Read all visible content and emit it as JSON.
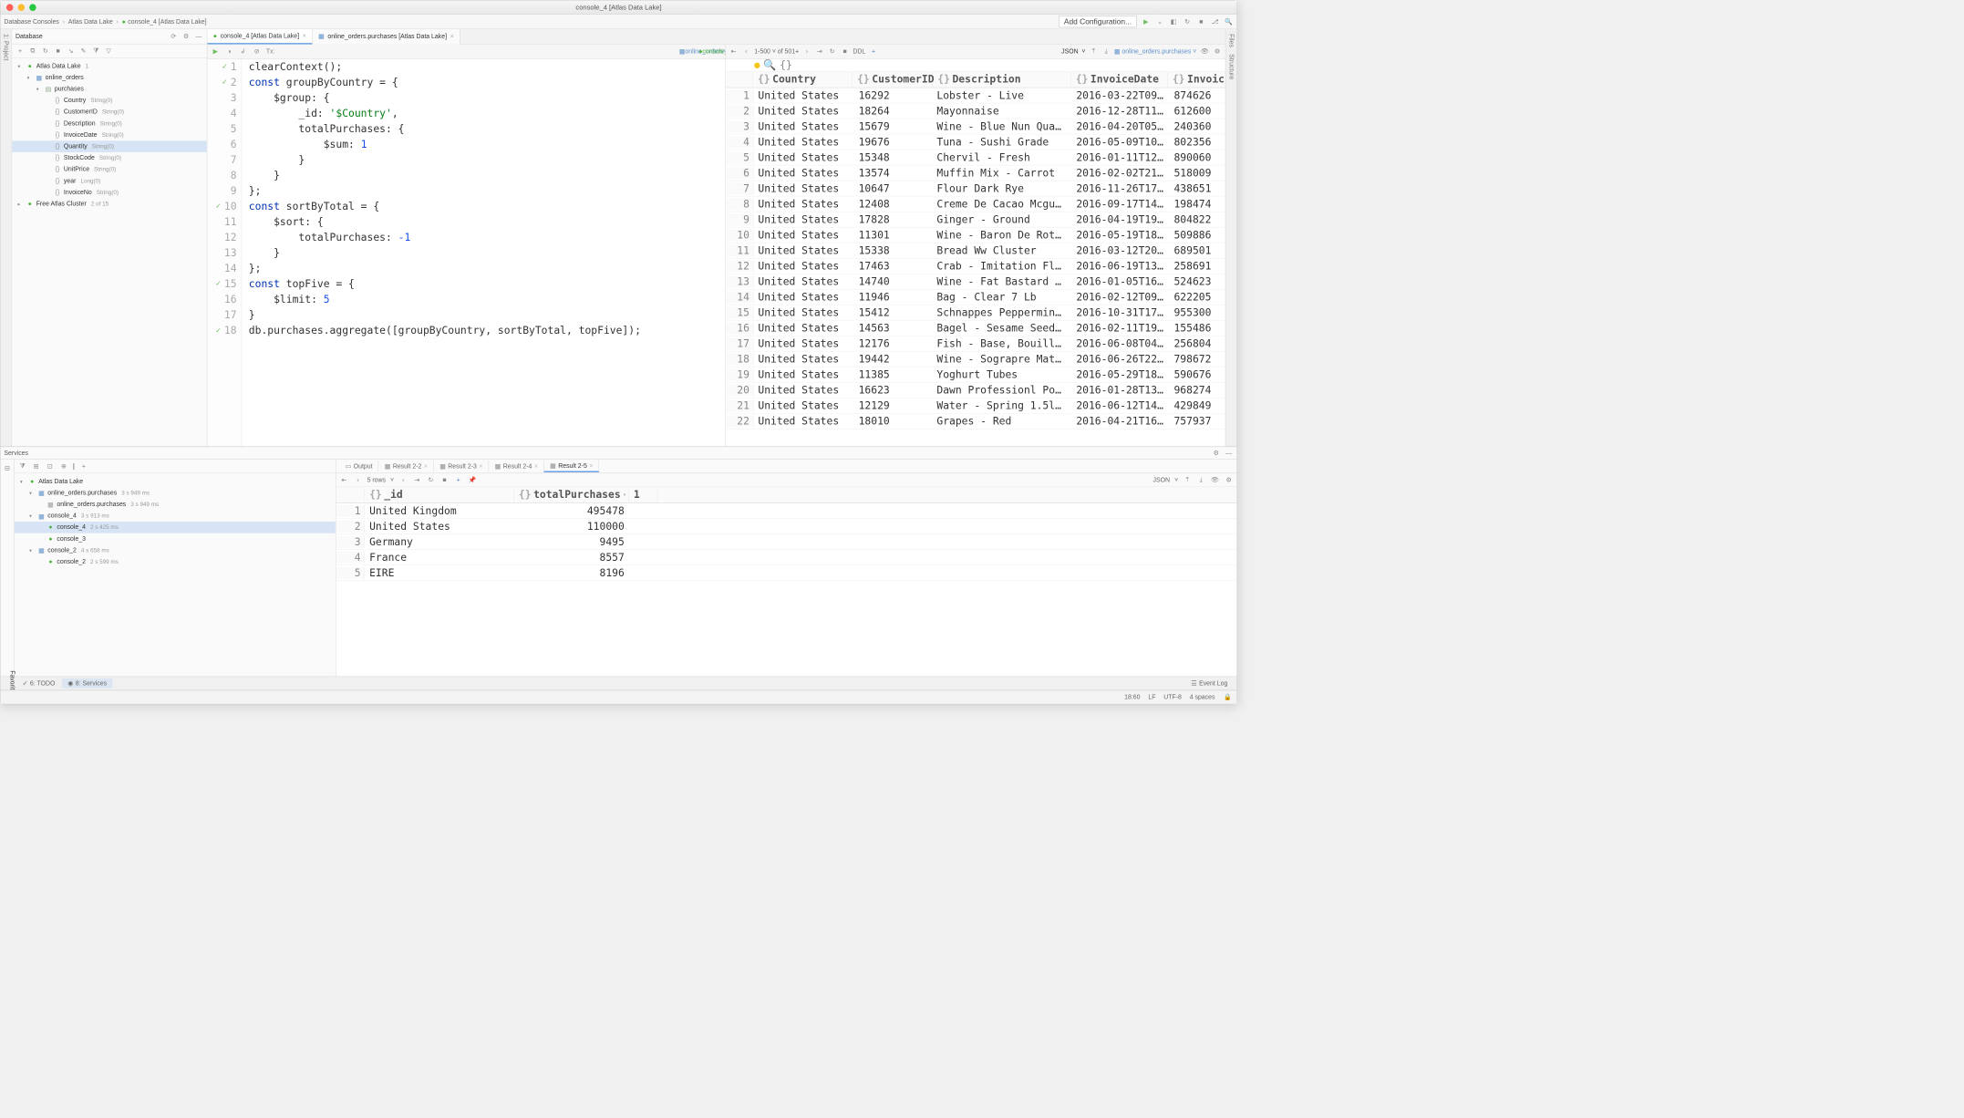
{
  "window_title": "console_4 [Atlas Data Lake]",
  "breadcrumbs": [
    "Database Consoles",
    "Atlas Data Lake",
    "console_4 [Atlas Data Lake]"
  ],
  "nav": {
    "add_config": "Add Configuration..."
  },
  "left_gutter": [
    "1: Project"
  ],
  "right_gutter": [
    "Files",
    "Structure"
  ],
  "db_panel": {
    "title": "Database",
    "tree": [
      {
        "depth": 0,
        "arrow": "open",
        "icon": "mongo",
        "label": "Atlas Data Lake",
        "badge": "1"
      },
      {
        "depth": 1,
        "arrow": "open",
        "icon": "db",
        "label": "online_orders"
      },
      {
        "depth": 2,
        "arrow": "open",
        "icon": "coll",
        "label": "purchases"
      },
      {
        "depth": 3,
        "arrow": "",
        "icon": "field",
        "label": "Country",
        "badge": "String(0)"
      },
      {
        "depth": 3,
        "arrow": "",
        "icon": "field",
        "label": "CustomerID",
        "badge": "String(0)"
      },
      {
        "depth": 3,
        "arrow": "",
        "icon": "field",
        "label": "Description",
        "badge": "String(0)"
      },
      {
        "depth": 3,
        "arrow": "",
        "icon": "field",
        "label": "InvoiceDate",
        "badge": "String(0)"
      },
      {
        "depth": 3,
        "arrow": "",
        "icon": "field",
        "label": "Quantity",
        "badge": "String(0)",
        "selected": true
      },
      {
        "depth": 3,
        "arrow": "",
        "icon": "field",
        "label": "StockCode",
        "badge": "String(0)"
      },
      {
        "depth": 3,
        "arrow": "",
        "icon": "field",
        "label": "UnitPrice",
        "badge": "String(0)"
      },
      {
        "depth": 3,
        "arrow": "",
        "icon": "field",
        "label": "year",
        "badge": "Long(0)"
      },
      {
        "depth": 3,
        "arrow": "",
        "icon": "field",
        "label": "InvoiceNo",
        "badge": "String(0)"
      },
      {
        "depth": 0,
        "arrow": "closed",
        "icon": "mongo",
        "label": "Free Atlas Cluster",
        "badge": "2 of 15"
      }
    ]
  },
  "editor": {
    "tabs": [
      {
        "label": "console_4 [Atlas Data Lake]",
        "active": true
      },
      {
        "label": "online_orders.purchases [Atlas Data Lake]",
        "active": false
      }
    ],
    "context_left": "online_orders",
    "context_right": "console_4",
    "lines": [
      {
        "n": 1,
        "check": true,
        "html": "clearContext();"
      },
      {
        "n": 2,
        "check": true,
        "html": "<span class='tok-kw'>const</span> groupByCountry = {"
      },
      {
        "n": 3,
        "html": "    $group: {"
      },
      {
        "n": 4,
        "html": "        _id: <span class='tok-str'>'$Country'</span>,"
      },
      {
        "n": 5,
        "html": "        totalPurchases: {"
      },
      {
        "n": 6,
        "html": "            $sum: <span class='tok-num'>1</span>"
      },
      {
        "n": 7,
        "html": "        }"
      },
      {
        "n": 8,
        "html": "    }"
      },
      {
        "n": 9,
        "html": "};"
      },
      {
        "n": 10,
        "check": true,
        "html": "<span class='tok-kw'>const</span> sortByTotal = {"
      },
      {
        "n": 11,
        "html": "    $sort: {"
      },
      {
        "n": 12,
        "html": "        totalPurchases: <span class='tok-num'>-1</span>"
      },
      {
        "n": 13,
        "html": "    }"
      },
      {
        "n": 14,
        "html": "};"
      },
      {
        "n": 15,
        "check": true,
        "html": "<span class='tok-kw'>const</span> topFive = {"
      },
      {
        "n": 16,
        "html": "    $limit: <span class='tok-num'>5</span>"
      },
      {
        "n": 17,
        "html": "}"
      },
      {
        "n": 18,
        "check": true,
        "html": "db.purchases.aggregate([groupByCountry, sortByTotal, topFive]);"
      }
    ]
  },
  "results": {
    "pager_range": "1-500",
    "pager_total": "of 501+",
    "ddl_label": "DDL",
    "view_mode": "JSON",
    "path_label": "online_orders.purchases",
    "root_brace": "{}",
    "columns": [
      "Country",
      "CustomerID",
      "Description",
      "InvoiceDate",
      "Invoic"
    ],
    "rows": [
      [
        "United States",
        "16292",
        "Lobster - Live",
        "2016-03-22T09…",
        "874626"
      ],
      [
        "United States",
        "18264",
        "Mayonnaise",
        "2016-12-28T11…",
        "612600"
      ],
      [
        "United States",
        "15679",
        "Wine - Blue Nun Qual…",
        "2016-04-20T05…",
        "240360"
      ],
      [
        "United States",
        "19676",
        "Tuna - Sushi Grade",
        "2016-05-09T10…",
        "802356"
      ],
      [
        "United States",
        "15348",
        "Chervil - Fresh",
        "2016-01-11T12…",
        "890060"
      ],
      [
        "United States",
        "13574",
        "Muffin Mix - Carrot",
        "2016-02-02T21…",
        "518009"
      ],
      [
        "United States",
        "10647",
        "Flour Dark Rye",
        "2016-11-26T17…",
        "438651"
      ],
      [
        "United States",
        "12408",
        "Creme De Cacao Mcgui…",
        "2016-09-17T14…",
        "198474"
      ],
      [
        "United States",
        "17828",
        "Ginger - Ground",
        "2016-04-19T19…",
        "804822"
      ],
      [
        "United States",
        "11301",
        "Wine - Baron De Roth…",
        "2016-05-19T18…",
        "509886"
      ],
      [
        "United States",
        "15338",
        "Bread Ww Cluster",
        "2016-03-12T20…",
        "689501"
      ],
      [
        "United States",
        "17463",
        "Crab - Imitation Fla…",
        "2016-06-19T13…",
        "258691"
      ],
      [
        "United States",
        "14740",
        "Wine - Fat Bastard M…",
        "2016-01-05T16…",
        "524623"
      ],
      [
        "United States",
        "11946",
        "Bag - Clear 7 Lb",
        "2016-02-12T09…",
        "622205"
      ],
      [
        "United States",
        "15412",
        "Schnappes Peppermint…",
        "2016-10-31T17…",
        "955300"
      ],
      [
        "United States",
        "14563",
        "Bagel - Sesame Seed …",
        "2016-02-11T19…",
        "155486"
      ],
      [
        "United States",
        "12176",
        "Fish - Base, Bouillion",
        "2016-06-08T04…",
        "256804"
      ],
      [
        "United States",
        "19442",
        "Wine - Sograpre Mateu…",
        "2016-06-26T22…",
        "798672"
      ],
      [
        "United States",
        "11385",
        "Yoghurt Tubes",
        "2016-05-29T18…",
        "590676"
      ],
      [
        "United States",
        "16623",
        "Dawn Professionl Pot…",
        "2016-01-28T13…",
        "968274"
      ],
      [
        "United States",
        "12129",
        "Water - Spring 1.5lit",
        "2016-06-12T14…",
        "429849"
      ],
      [
        "United States",
        "18010",
        "Grapes - Red",
        "2016-04-21T16…",
        "757937"
      ]
    ]
  },
  "services": {
    "title": "Services",
    "rows_label": "5 rows",
    "view_mode": "JSON",
    "tree": [
      {
        "depth": 0,
        "arrow": "open",
        "icon": "mongo",
        "label": "Atlas Data Lake"
      },
      {
        "depth": 1,
        "arrow": "open",
        "icon": "db",
        "label": "online_orders.purchases",
        "badge": "3 s 949 ms"
      },
      {
        "depth": 2,
        "arrow": "",
        "icon": "grid",
        "label": "online_orders.purchases",
        "badge": "3 s 949 ms"
      },
      {
        "depth": 1,
        "arrow": "open",
        "icon": "db",
        "label": "console_4",
        "badge": "3 s 913 ms"
      },
      {
        "depth": 2,
        "arrow": "",
        "icon": "mongo",
        "label": "console_4",
        "badge": "2 s 425 ms",
        "selected": true
      },
      {
        "depth": 2,
        "arrow": "",
        "icon": "mongo",
        "label": "console_3"
      },
      {
        "depth": 1,
        "arrow": "open",
        "icon": "db",
        "label": "console_2",
        "badge": "4 s 658 ms"
      },
      {
        "depth": 2,
        "arrow": "",
        "icon": "mongo",
        "label": "console_2",
        "badge": "2 s 599 ms"
      }
    ],
    "tabs": [
      "Output",
      "Result 2-2",
      "Result 2-3",
      "Result 2-4",
      "Result 2-5"
    ],
    "active_tab": 4,
    "columns": [
      "_id",
      "totalPurchases",
      "1"
    ],
    "data": [
      [
        "United Kingdom",
        "495478",
        ""
      ],
      [
        "United States",
        "110000",
        ""
      ],
      [
        "Germany",
        "9495",
        ""
      ],
      [
        "France",
        "8557",
        ""
      ],
      [
        "EIRE",
        "8196",
        ""
      ]
    ]
  },
  "bottom_tools": {
    "todo": "6: TODO",
    "services": "8: Services",
    "event_log": "Event Log"
  },
  "status": {
    "pos": "18:60",
    "lf": "LF",
    "enc": "UTF-8",
    "indent": "4 spaces"
  },
  "favorites_label": "Favorites"
}
